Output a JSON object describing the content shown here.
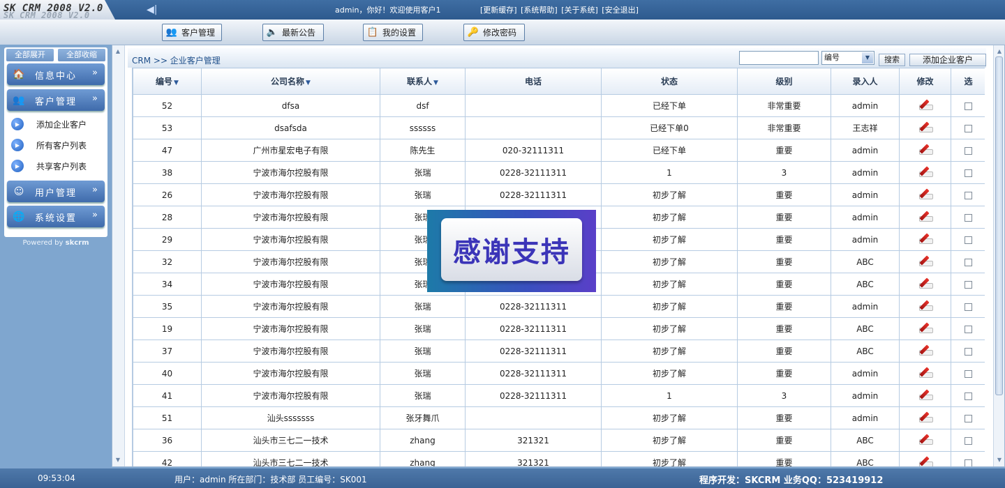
{
  "header": {
    "logo_text": "SK CRM 2008 V2.0",
    "logo_ghost": "SK CRM 2008 V2.0",
    "welcome": "admin，你好！欢迎使用客户1",
    "links": [
      "[更新缓存]",
      "[系统帮助]",
      "[关于系统]",
      "[安全退出]"
    ]
  },
  "nav_tabs": [
    {
      "label": "客户管理",
      "icon": "users-icon"
    },
    {
      "label": "最新公告",
      "icon": "speaker-icon"
    },
    {
      "label": "我的设置",
      "icon": "clipboard-icon"
    },
    {
      "label": "修改密码",
      "icon": "key-icon"
    }
  ],
  "sidebar": {
    "expand_all": "全部展开",
    "collapse_all": "全部收缩",
    "menus": [
      {
        "label": "信息中心",
        "icon": "home-icon"
      },
      {
        "label": "客户管理",
        "icon": "users-icon"
      },
      {
        "label": "用户管理",
        "icon": "smiley-icon"
      },
      {
        "label": "系统设置",
        "icon": "globe-icon"
      }
    ],
    "sub_items": [
      "添加企业客户",
      "所有客户列表",
      "共享客户列表"
    ],
    "powered_prefix": "Powered by ",
    "powered_brand": "skcrm"
  },
  "main": {
    "breadcrumb": "CRM >> 企业客户管理",
    "search_value": "",
    "search_field": "编号",
    "search_button": "搜索",
    "add_button": "添加企业客户"
  },
  "table": {
    "columns": [
      {
        "label": "编号",
        "sortable": true
      },
      {
        "label": "公司名称",
        "sortable": true
      },
      {
        "label": "联系人",
        "sortable": true
      },
      {
        "label": "电话",
        "sortable": false
      },
      {
        "label": "状态",
        "sortable": false
      },
      {
        "label": "级别",
        "sortable": false
      },
      {
        "label": "录入人",
        "sortable": false
      },
      {
        "label": "修改",
        "sortable": false
      },
      {
        "label": "选",
        "sortable": false
      }
    ],
    "rows": [
      [
        "52",
        "dfsa",
        "dsf",
        "",
        "已经下单",
        "非常重要",
        "admin"
      ],
      [
        "53",
        "dsafsda",
        "ssssss",
        "",
        "已经下单0",
        "非常重要",
        "王志祥"
      ],
      [
        "47",
        "广州市星宏电子有限",
        "陈先生",
        "020-32111311",
        "已经下单",
        "重要",
        "admin"
      ],
      [
        "38",
        "宁波市海尔控股有限",
        "张瑞",
        "0228-32111311",
        "1",
        "3",
        "admin"
      ],
      [
        "26",
        "宁波市海尔控股有限",
        "张瑞",
        "0228-32111311",
        "初步了解",
        "重要",
        "admin"
      ],
      [
        "28",
        "宁波市海尔控股有限",
        "张瑞",
        "",
        "初步了解",
        "重要",
        "admin"
      ],
      [
        "29",
        "宁波市海尔控股有限",
        "张瑞",
        "",
        "初步了解",
        "重要",
        "admin"
      ],
      [
        "32",
        "宁波市海尔控股有限",
        "张瑞",
        "",
        "初步了解",
        "重要",
        "ABC"
      ],
      [
        "34",
        "宁波市海尔控股有限",
        "张瑞",
        "",
        "初步了解",
        "重要",
        "ABC"
      ],
      [
        "35",
        "宁波市海尔控股有限",
        "张瑞",
        "0228-32111311",
        "初步了解",
        "重要",
        "admin"
      ],
      [
        "19",
        "宁波市海尔控股有限",
        "张瑞",
        "0228-32111311",
        "初步了解",
        "重要",
        "ABC"
      ],
      [
        "37",
        "宁波市海尔控股有限",
        "张瑞",
        "0228-32111311",
        "初步了解",
        "重要",
        "ABC"
      ],
      [
        "40",
        "宁波市海尔控股有限",
        "张瑞",
        "0228-32111311",
        "初步了解",
        "重要",
        "admin"
      ],
      [
        "41",
        "宁波市海尔控股有限",
        "张瑞",
        "0228-32111311",
        "1",
        "3",
        "admin"
      ],
      [
        "51",
        "汕头sssssss",
        "张牙舞爪",
        "",
        "初步了解",
        "重要",
        "admin"
      ],
      [
        "36",
        "汕头市三七二一技术",
        "zhang",
        "321321",
        "初步了解",
        "重要",
        "ABC"
      ],
      [
        "42",
        "汕头市三七二一技术",
        "zhang",
        "321321",
        "初步了解",
        "重要",
        "ABC"
      ]
    ]
  },
  "popup": {
    "text": "感谢支持"
  },
  "footer": {
    "clock": "09:53:04",
    "user_info": "用户：admin  所在部门：技术部   员工编号：SK001",
    "credit": "程序开发：SKCRM 业务QQ：523419912"
  },
  "colors": {
    "header_bg": "#2e5a8e",
    "menu_blue": "#3f6bab",
    "accent_red": "#d0231c"
  }
}
